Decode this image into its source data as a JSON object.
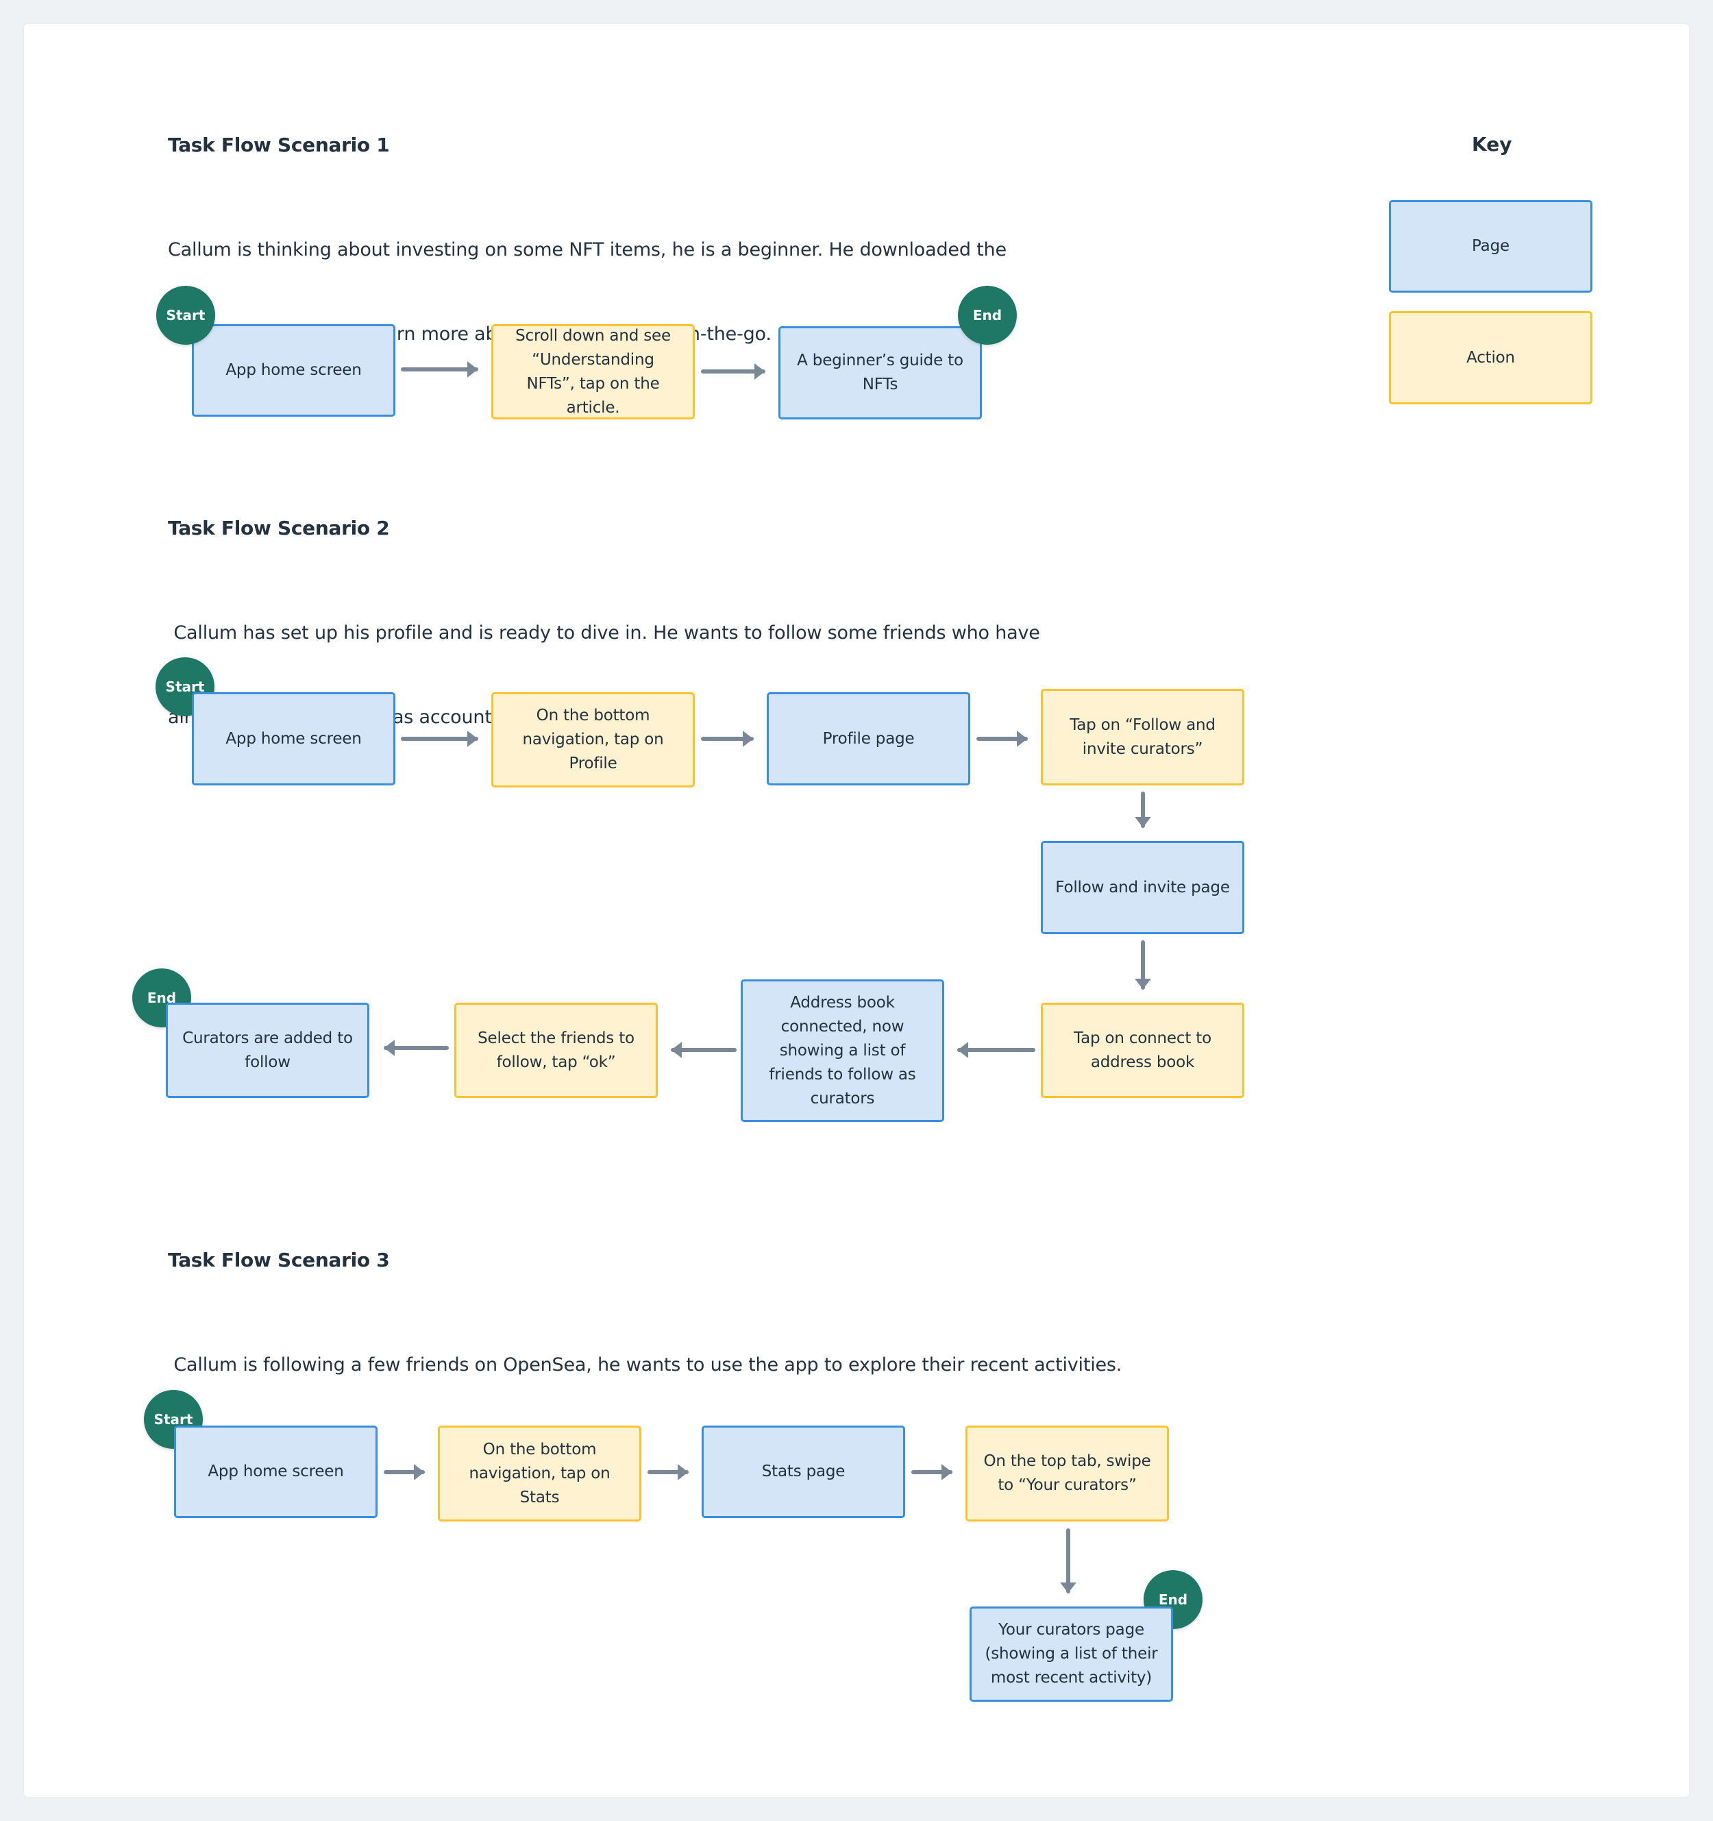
{
  "colors": {
    "page_fill": "#D3E5F6",
    "page_border": "#3A8FDD",
    "action_fill": "#FEF2D1",
    "action_border": "#F8C233",
    "terminal": "#1F7765",
    "arrow": "#7A8896",
    "text": "#24323F"
  },
  "key": {
    "title": "Key",
    "items": [
      {
        "type": "page",
        "label": "Page"
      },
      {
        "type": "action",
        "label": "Action"
      }
    ]
  },
  "terminals": {
    "start": "Start",
    "end": "End"
  },
  "scenarios": [
    {
      "title": "Task Flow Scenario 1",
      "description_lines": [
        "Callum is thinking about investing on some NFT items, he is a beginner. He downloaded the",
        "app and would like to learn more about NFTs in general on-the-go."
      ],
      "steps": [
        {
          "type": "page",
          "label": "App home screen"
        },
        {
          "type": "action",
          "label": "Scroll down and see “Understanding NFTs”, tap on the article."
        },
        {
          "type": "page",
          "label": "A beginner’s guide to NFTs"
        }
      ]
    },
    {
      "title": "Task Flow Scenario 2",
      "description_lines": [
        " Callum has set up his profile and is ready to dive in. He wants to follow some friends who have",
        "already have an OpenSeas account."
      ],
      "steps": [
        {
          "type": "page",
          "label": "App home screen"
        },
        {
          "type": "action",
          "label": "On the bottom navigation, tap on Profile"
        },
        {
          "type": "page",
          "label": "Profile page"
        },
        {
          "type": "action",
          "label": "Tap on “Follow and invite curators”"
        },
        {
          "type": "page",
          "label": "Follow and invite page"
        },
        {
          "type": "action",
          "label": "Tap on connect to address book"
        },
        {
          "type": "page",
          "label": "Address book connected, now showing a list of friends to follow as curators"
        },
        {
          "type": "action",
          "label": "Select the friends to follow, tap “ok”"
        },
        {
          "type": "page",
          "label": "Curators are added to follow"
        }
      ]
    },
    {
      "title": "Task Flow Scenario 3",
      "description_lines": [
        " Callum is following a few friends on OpenSea, he wants to use the app to explore their recent activities."
      ],
      "steps": [
        {
          "type": "page",
          "label": "App home screen"
        },
        {
          "type": "action",
          "label": "On the bottom navigation, tap on Stats"
        },
        {
          "type": "page",
          "label": "Stats page"
        },
        {
          "type": "action",
          "label": "On the top tab, swipe to “Your curators”"
        },
        {
          "type": "page",
          "label": "Your curators page (showing a list of their most recent activity)"
        }
      ]
    }
  ]
}
